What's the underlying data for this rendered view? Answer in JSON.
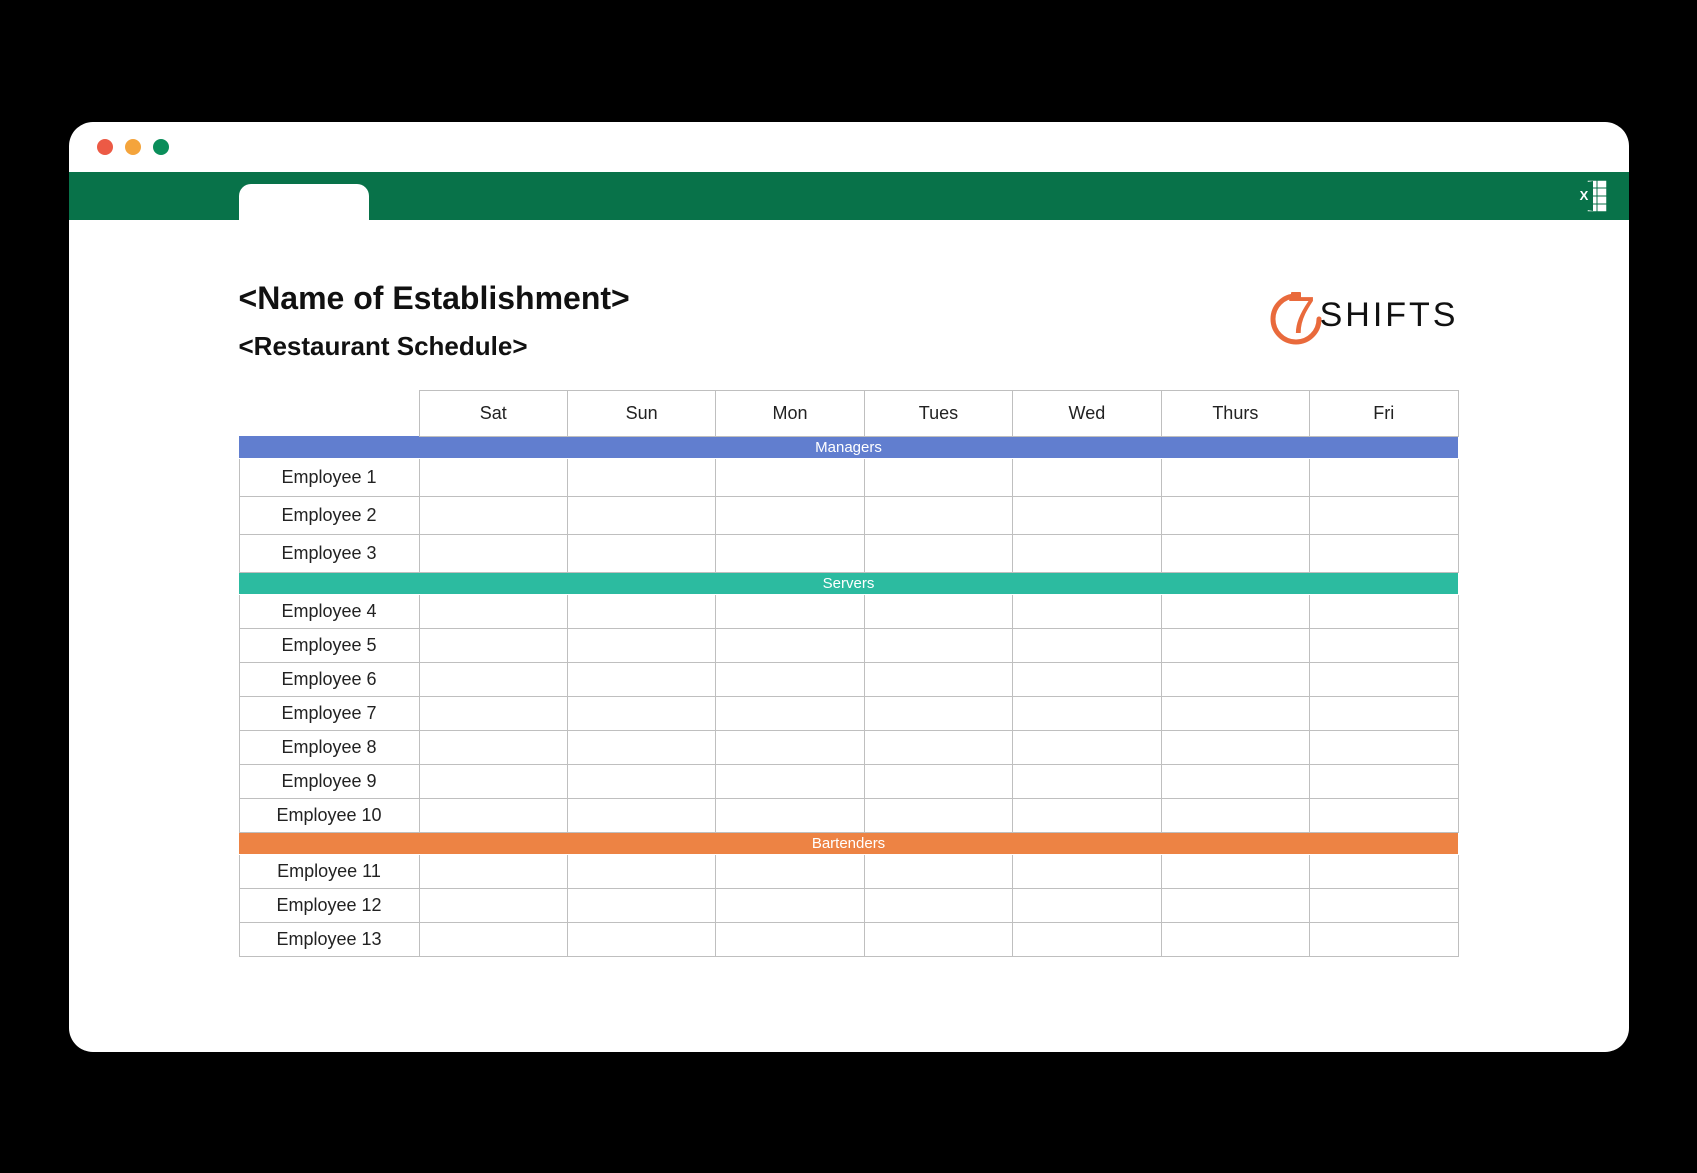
{
  "titles": {
    "establishment": "<Name of Establishment>",
    "schedule": "<Restaurant Schedule>"
  },
  "logo": {
    "seven": "7",
    "shifts": "SHIFTS"
  },
  "days": [
    "Sat",
    "Sun",
    "Mon",
    "Tues",
    "Wed",
    "Thurs",
    "Fri"
  ],
  "sections": [
    {
      "label": "Managers",
      "color": "blue",
      "employees": [
        "Employee 1",
        "Employee 2",
        "Employee 3"
      ]
    },
    {
      "label": "Servers",
      "color": "teal",
      "employees": [
        "Employee 4",
        "Employee 5",
        "Employee 6",
        "Employee 7",
        "Employee 8",
        "Employee 9",
        "Employee 10"
      ]
    },
    {
      "label": "Bartenders",
      "color": "orange",
      "employees": [
        "Employee 11",
        "Employee 12",
        "Employee 13"
      ]
    }
  ]
}
